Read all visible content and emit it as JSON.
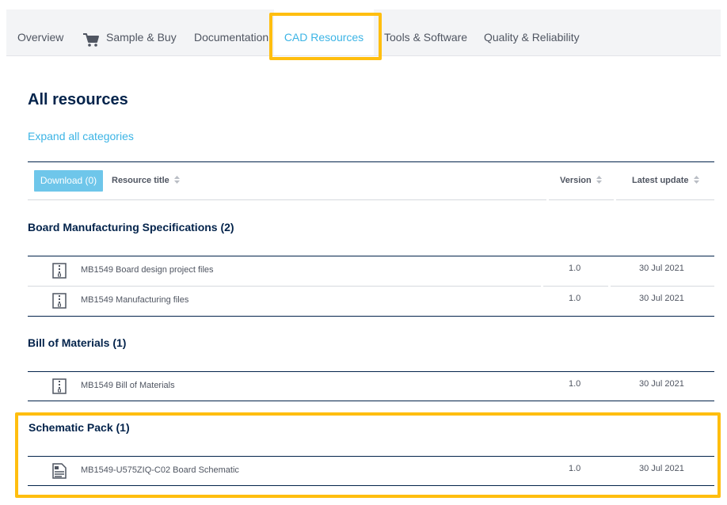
{
  "tabs": {
    "overview": "Overview",
    "sample_buy": "Sample & Buy",
    "documentation": "Documentation",
    "cad_resources": "CAD Resources",
    "tools_software": "Tools & Software",
    "quality_reliability": "Quality & Reliability",
    "active": "CAD Resources"
  },
  "icons": {
    "cart": "shopping-cart-icon",
    "archive": "zip-archive-icon",
    "schematic": "schematic-document-icon",
    "sort": "sort-icon"
  },
  "heading": "All resources",
  "expand_link": "Expand all categories",
  "table_header": {
    "download_button": "Download (0)",
    "resource_title": "Resource title",
    "version": "Version",
    "latest_update": "Latest update"
  },
  "categories": [
    {
      "title": "Board Manufacturing Specifications (2)",
      "rows": [
        {
          "title": "MB1549 Board design project files",
          "version": "1.0",
          "date": "30 Jul 2021"
        },
        {
          "title": "MB1549 Manufacturing files",
          "version": "1.0",
          "date": "30 Jul 2021"
        }
      ]
    },
    {
      "title": "Bill of Materials (1)",
      "rows": [
        {
          "title": "MB1549 Bill of Materials",
          "version": "1.0",
          "date": "30 Jul 2021"
        }
      ]
    },
    {
      "title": "Schematic Pack (1)",
      "rows": [
        {
          "title": "MB1549-U575ZIQ-C02 Board Schematic",
          "version": "1.0",
          "date": "30 Jul 2021"
        }
      ]
    }
  ],
  "colors": {
    "accent": "#3cb4e5",
    "heading": "#03234b",
    "highlight": "#ffbe0f",
    "button": "#6ec6ea"
  }
}
